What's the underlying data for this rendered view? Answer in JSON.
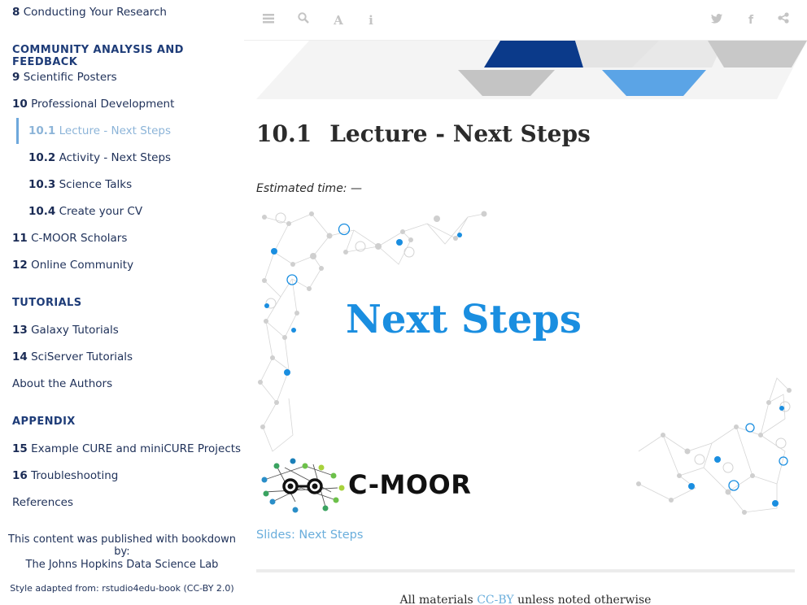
{
  "sidebar": {
    "items": [
      {
        "num": "8",
        "label": "Conducting Your Research"
      },
      {
        "header": "COMMUNITY ANALYSIS AND FEEDBACK"
      },
      {
        "num": "9",
        "label": "Scientific Posters"
      },
      {
        "num": "10",
        "label": "Professional Development"
      },
      {
        "num": "10.1",
        "label": "Lecture - Next Steps",
        "active": true
      },
      {
        "num": "10.2",
        "label": "Activity - Next Steps"
      },
      {
        "num": "10.3",
        "label": "Science Talks"
      },
      {
        "num": "10.4",
        "label": "Create your CV"
      },
      {
        "num": "11",
        "label": "C-MOOR Scholars"
      },
      {
        "num": "12",
        "label": "Online Community"
      },
      {
        "header": "TUTORIALS"
      },
      {
        "num": "13",
        "label": "Galaxy Tutorials"
      },
      {
        "num": "14",
        "label": "SciServer Tutorials"
      },
      {
        "label": "About the Authors"
      },
      {
        "header": "APPENDIX"
      },
      {
        "num": "15",
        "label": "Example CURE and miniCURE Projects"
      },
      {
        "num": "16",
        "label": "Troubleshooting"
      },
      {
        "label": "References"
      }
    ],
    "published_text": "This content was published with bookdown by:",
    "jhu_text": "The Johns Hopkins Data Science Lab",
    "style_text": "Style adapted from: rstudio4edu-book (CC-BY 2.0)"
  },
  "toolbar": {
    "icons": [
      "menu-icon",
      "search-icon",
      "font-icon",
      "info-icon",
      "twitter-icon",
      "facebook-icon",
      "share-icon"
    ]
  },
  "main": {
    "heading_num": "10.1",
    "heading_text": "Lecture - Next Steps",
    "estimated_time": "Estimated time: —",
    "slide_title": "Next Steps",
    "logo_text": "C-MOOR",
    "slides_link": "Slides: Next Steps",
    "footer_prefix": "All materials ",
    "footer_link": "CC-BY",
    "footer_suffix": " unless noted otherwise"
  },
  "colors": {
    "navy": "#1a2b55",
    "accent_blue": "#1a8ee0",
    "link_blue": "#6aaedc",
    "banner_dark": "#0b3a8a",
    "banner_light": "#5ba4e6"
  }
}
